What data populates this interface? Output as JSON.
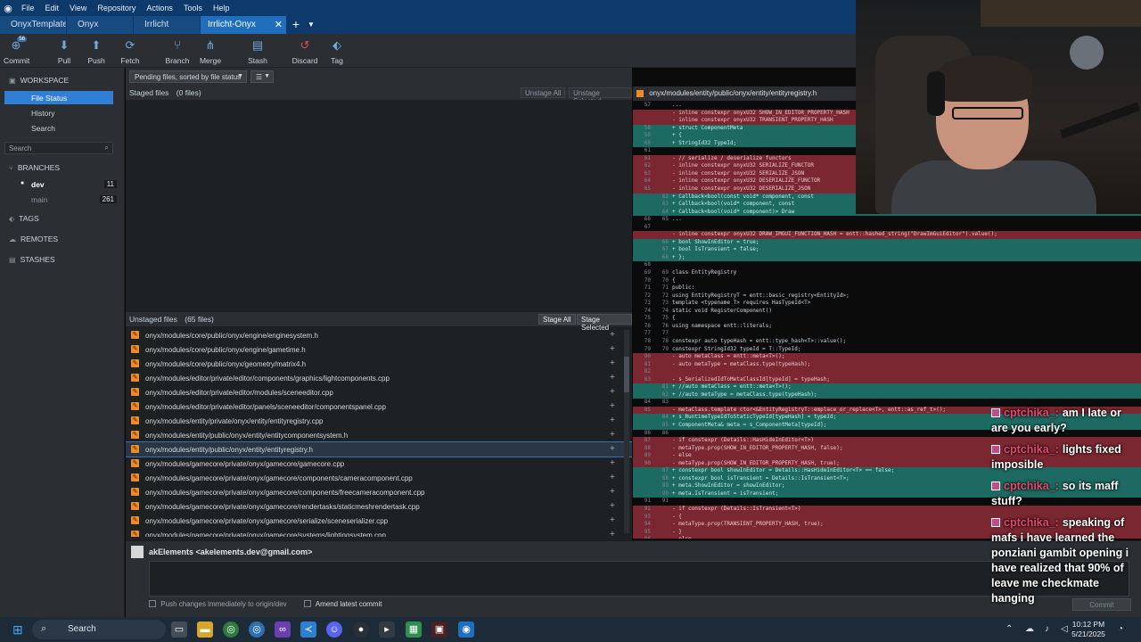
{
  "menubar": {
    "items": [
      "File",
      "Edit",
      "View",
      "Repository",
      "Actions",
      "Tools",
      "Help"
    ]
  },
  "tabs": [
    {
      "label": "OnyxTemplate"
    },
    {
      "label": "Onyx"
    },
    {
      "label": "Irrlicht"
    },
    {
      "label": "Irrlicht-Onyx"
    }
  ],
  "toolbar": {
    "commit": "Commit",
    "commit_badge": "56",
    "pull": "Pull",
    "push": "Push",
    "fetch": "Fetch",
    "branch": "Branch",
    "merge": "Merge",
    "stash": "Stash",
    "discard": "Discard",
    "tag": "Tag"
  },
  "sidebar": {
    "workspace": "WORKSPACE",
    "file_status": "File Status",
    "history": "History",
    "search_item": "Search",
    "search_placeholder": "Search",
    "branches": "BRANCHES",
    "branch_dev": "dev",
    "branch_dev_count": "11",
    "branch_main": "main",
    "branch_main_count": "261",
    "tags": "TAGS",
    "remotes": "REMOTES",
    "stashes": "STASHES"
  },
  "center": {
    "filter_select": "Pending files, sorted by file status",
    "view_select": "☰",
    "staged_label": "Staged files",
    "staged_count": "(0 files)",
    "unstage_all": "Unstage All",
    "unstage_selected": "Unstage Selected",
    "unstaged_label": "Unstaged files",
    "unstaged_count": "(65 files)",
    "stage_all": "Stage All",
    "stage_selected": "Stage Selected",
    "files": [
      "onyx/modules/core/public/onyx/engine/enginesystem.h",
      "onyx/modules/core/public/onyx/engine/gametime.h",
      "onyx/modules/core/public/onyx/geometry/matrix4.h",
      "onyx/modules/editor/private/editor/components/graphics/lightcomponents.cpp",
      "onyx/modules/editor/private/editor/modules/sceneeditor.cpp",
      "onyx/modules/editor/private/editor/panels/sceneeditor/componentspanel.cpp",
      "onyx/modules/entity/private/onyx/entity/entityregistry.cpp",
      "onyx/modules/entity/public/onyx/entity/entitycomponentsystem.h",
      "onyx/modules/entity/public/onyx/entity/entityregistry.h",
      "onyx/modules/gamecore/private/onyx/gamecore/gamecore.cpp",
      "onyx/modules/gamecore/private/onyx/gamecore/components/cameracomponent.cpp",
      "onyx/modules/gamecore/private/onyx/gamecore/components/freecameracomponent.cpp",
      "onyx/modules/gamecore/private/onyx/gamecore/rendertasks/staticmeshrendertask.cpp",
      "onyx/modules/gamecore/private/onyx/gamecore/serialize/sceneserializer.cpp",
      "onyx/modules/gamecore/private/onyx/gamecore/systems/lightingsystem.cpp"
    ]
  },
  "diff": {
    "file_path": "onyx/modules/entity/public/onyx/entity/entityregistry.h",
    "lines": [
      {
        "t": "ctx",
        "a": "57",
        "b": "",
        "c": "..."
      },
      {
        "t": "del",
        "a": "",
        "b": "",
        "c": "-            inline constexpr onyxU32 SHOW_IN_EDITOR_PROPERTY_HASH"
      },
      {
        "t": "del",
        "a": "",
        "b": "",
        "c": "-            inline constexpr onyxU32 TRANSIENT_PROPERTY_HASH"
      },
      {
        "t": "add",
        "a": "58",
        "b": "",
        "c": "+        struct ComponentMeta"
      },
      {
        "t": "add",
        "a": "59",
        "b": "",
        "c": "+        {"
      },
      {
        "t": "add",
        "a": "60",
        "b": "",
        "c": "+            StringId32 TypeId;"
      },
      {
        "t": "ctx",
        "a": "61",
        "b": "",
        "c": ""
      },
      {
        "t": "del",
        "a": "61",
        "b": "",
        "c": "-        // serialize / deserialize functors"
      },
      {
        "t": "del",
        "a": "62",
        "b": "",
        "c": "-        inline constexpr onyxU32 SERIALIZE_FUNCTOR"
      },
      {
        "t": "del",
        "a": "63",
        "b": "",
        "c": "-        inline constexpr onyxU32 SERIALIZE_JSON"
      },
      {
        "t": "del",
        "a": "64",
        "b": "",
        "c": "-        inline constexpr onyxU32 DESERIALIZE_FUNCTOR"
      },
      {
        "t": "del",
        "a": "65",
        "b": "",
        "c": "-        inline constexpr onyxU32 DESERIALIZE_JSON"
      },
      {
        "t": "add",
        "a": "",
        "b": "62",
        "c": "+            Callback<bool(const void* component, const"
      },
      {
        "t": "add",
        "a": "",
        "b": "63",
        "c": "+            Callback<bool(void* component, const"
      },
      {
        "t": "add",
        "a": "",
        "b": "64",
        "c": "+            Callback<bool(void* component)> Draw"
      },
      {
        "t": "ctx",
        "a": "66",
        "b": "65",
        "c": "..."
      },
      {
        "t": "ctx",
        "a": "67",
        "b": "",
        "c": ""
      },
      {
        "t": "del",
        "a": "",
        "b": "",
        "c": "-        inline constexpr onyxU32 DRAW_IMGUI_FUNCTION_HASH = entt::hashed_string(\"DrawImGuiEditor\").value();"
      },
      {
        "t": "add",
        "a": "",
        "b": "66",
        "c": "+            bool ShowInEditor = true;"
      },
      {
        "t": "add",
        "a": "",
        "b": "67",
        "c": "+            bool IsTransient = false;"
      },
      {
        "t": "add",
        "a": "",
        "b": "68",
        "c": "+        };"
      },
      {
        "t": "ctx",
        "a": "68",
        "b": "",
        "c": ""
      },
      {
        "t": "ctx",
        "a": "69",
        "b": "69",
        "c": "        class EntityRegistry"
      },
      {
        "t": "ctx",
        "a": "70",
        "b": "70",
        "c": "        {"
      },
      {
        "t": "ctx",
        "a": "71",
        "b": "71",
        "c": "        public:"
      },
      {
        "t": "ctx",
        "a": "72",
        "b": "72",
        "c": "            using EntityRegistryT = entt::basic_registry<EntityId>;"
      },
      {
        "t": "ctx",
        "a": "73",
        "b": "73",
        "c": "            template <typename T> requires HasTypeId<T>"
      },
      {
        "t": "ctx",
        "a": "74",
        "b": "74",
        "c": "            static void RegisterComponent()"
      },
      {
        "t": "ctx",
        "a": "75",
        "b": "75",
        "c": "            {"
      },
      {
        "t": "ctx",
        "a": "76",
        "b": "76",
        "c": "                using namespace entt::literals;"
      },
      {
        "t": "ctx",
        "a": "77",
        "b": "77",
        "c": ""
      },
      {
        "t": "ctx",
        "a": "78",
        "b": "78",
        "c": "                constexpr auto typeHash = entt::type_hash<T>::value();"
      },
      {
        "t": "ctx",
        "a": "79",
        "b": "79",
        "c": "                constexpr StringId32 typeId = T::TypeId;"
      },
      {
        "t": "del",
        "a": "80",
        "b": "",
        "c": "-                auto metaClass = entt::meta<T>();"
      },
      {
        "t": "del",
        "a": "81",
        "b": "",
        "c": "-                auto metaType = metaClass.type(typeHash);"
      },
      {
        "t": "del",
        "a": "82",
        "b": "",
        "c": ""
      },
      {
        "t": "del",
        "a": "83",
        "b": "",
        "c": "-                s_SerializedIdToMetaClassId[typeId] = typeHash;"
      },
      {
        "t": "add",
        "a": "",
        "b": "81",
        "c": "+                //auto metaClass = entt::meta<T>();"
      },
      {
        "t": "add",
        "a": "",
        "b": "82",
        "c": "+                //auto metaType = metaClass.type(typeHash);"
      },
      {
        "t": "ctx",
        "a": "84",
        "b": "83",
        "c": ""
      },
      {
        "t": "del",
        "a": "85",
        "b": "",
        "c": "-                metaClass.template ctor<&EntityRegistryT::emplace_or_replace<T>, entt::as_ref_t>();"
      },
      {
        "t": "add",
        "a": "",
        "b": "84",
        "c": "+                s_RuntimeTypeIdToStaticTypeId[typeHash] = typeId;"
      },
      {
        "t": "add",
        "a": "",
        "b": "85",
        "c": "+                ComponentMeta& meta = s_ComponentMeta[typeId];"
      },
      {
        "t": "ctx",
        "a": "86",
        "b": "86",
        "c": ""
      },
      {
        "t": "del",
        "a": "87",
        "b": "",
        "c": "-                if constexpr (Details::HasHideInEditor<T>)"
      },
      {
        "t": "del",
        "a": "88",
        "b": "",
        "c": "-                    metaType.prop(SHOW_IN_EDITOR_PROPERTY_HASH, false);"
      },
      {
        "t": "del",
        "a": "89",
        "b": "",
        "c": "-                else"
      },
      {
        "t": "del",
        "a": "90",
        "b": "",
        "c": "-                    metaType.prop(SHOW_IN_EDITOR_PROPERTY_HASH, true);"
      },
      {
        "t": "add",
        "a": "",
        "b": "87",
        "c": "+                constexpr bool showInEditor = Details::HasHideInEditor<T> == false;"
      },
      {
        "t": "add",
        "a": "",
        "b": "88",
        "c": "+                constexpr bool isTransient = Details::IsTransient<T>;"
      },
      {
        "t": "add",
        "a": "",
        "b": "89",
        "c": "+                meta.ShowInEditor = showInEditor;"
      },
      {
        "t": "add",
        "a": "",
        "b": "90",
        "c": "+                meta.IsTransient = isTransient;"
      },
      {
        "t": "ctx",
        "a": "91",
        "b": "91",
        "c": ""
      },
      {
        "t": "del",
        "a": "92",
        "b": "",
        "c": "-                if constexpr (Details::IsTransient<T>)"
      },
      {
        "t": "del",
        "a": "93",
        "b": "",
        "c": "-                {"
      },
      {
        "t": "del",
        "a": "94",
        "b": "",
        "c": "-                    metaType.prop(TRANSIENT_PROPERTY_HASH, true);"
      },
      {
        "t": "del",
        "a": "95",
        "b": "",
        "c": "-                }"
      },
      {
        "t": "del",
        "a": "96",
        "b": "",
        "c": "-                else"
      }
    ]
  },
  "chat": [
    {
      "user": "cptchika_:",
      "text": "am I late or are you early?"
    },
    {
      "user": "cptchika_:",
      "text": "lights fixed imposible"
    },
    {
      "user": "cptchika_:",
      "text": "so its maff stuff?"
    },
    {
      "user": "cptchika_:",
      "text": "speaking of mafs i have learned the ponziani gambit opening i have realized that 90% of leave me checkmate hanging"
    }
  ],
  "commit_area": {
    "author": "akElements <akelements.dev@gmail.com>",
    "push_immediately": "Push changes immediately to origin/dev",
    "amend": "Amend latest commit",
    "commit_button": "Commit"
  },
  "taskbar": {
    "search": "Search",
    "time": "10:12 PM",
    "date": "5/21/2025"
  },
  "colors": {
    "accent": "#2f7fd6",
    "titlebar": "#0d3a6b",
    "diff_removed": "#7a2731",
    "diff_added": "#1c6a62",
    "modified_icon": "#f08a24"
  }
}
